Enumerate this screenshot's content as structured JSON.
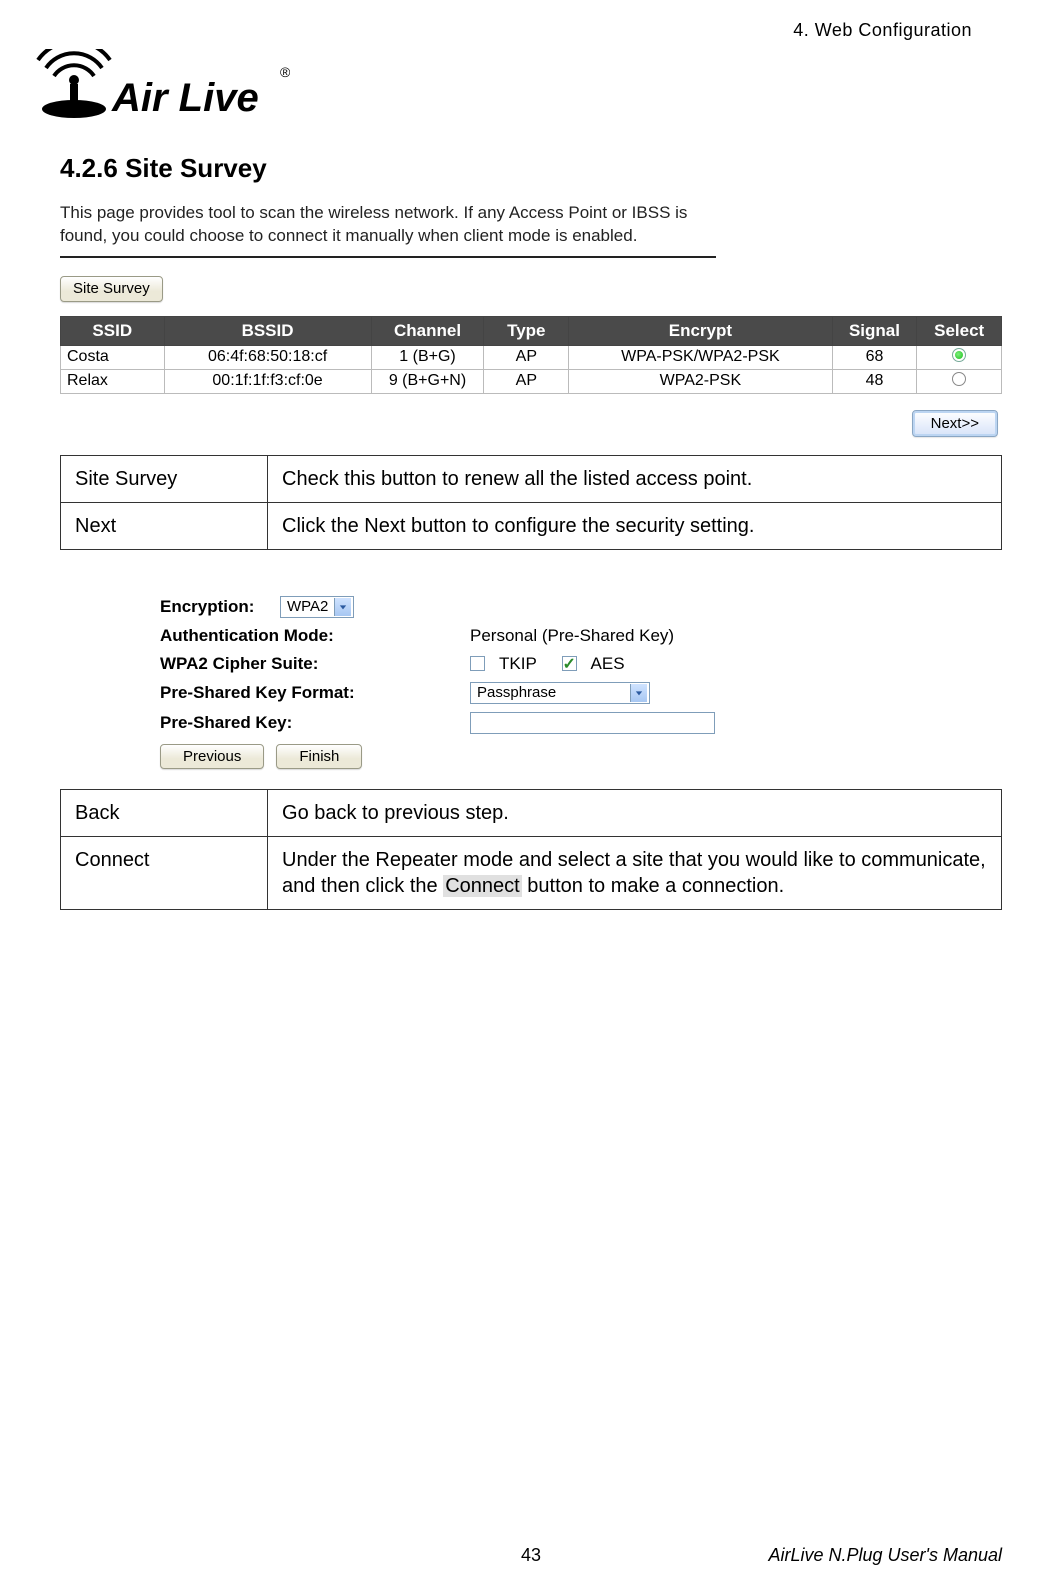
{
  "header": {
    "chapter": "4. Web Configuration",
    "logo_text": "Air Live",
    "logo_r": "®"
  },
  "section": {
    "number": "4.2.6",
    "title": "Site Survey"
  },
  "shot1": {
    "desc": "This page provides tool to scan the wireless network. If any Access Point or IBSS is found, you could choose to connect it manually when client mode is enabled.",
    "site_survey_btn": "Site Survey",
    "columns": {
      "ssid": "SSID",
      "bssid": "BSSID",
      "channel": "Channel",
      "type": "Type",
      "encrypt": "Encrypt",
      "signal": "Signal",
      "select": "Select"
    },
    "rows": [
      {
        "ssid": "Costa",
        "bssid": "06:4f:68:50:18:cf",
        "channel": "1 (B+G)",
        "type": "AP",
        "encrypt": "WPA-PSK/WPA2-PSK",
        "signal": "68",
        "selected": true
      },
      {
        "ssid": "Relax",
        "bssid": "00:1f:1f:f3:cf:0e",
        "channel": "9 (B+G+N)",
        "type": "AP",
        "encrypt": "WPA2-PSK",
        "signal": "48",
        "selected": false
      }
    ],
    "next_btn": "Next>>"
  },
  "table1": {
    "r0": {
      "k": "Site Survey",
      "v": "Check this button to renew all the listed access point."
    },
    "r1": {
      "k": "Next",
      "v": "Click the Next button to configure the security setting."
    }
  },
  "shot2": {
    "encryption_lbl": "Encryption:",
    "encryption_val": "WPA2",
    "auth_lbl": "Authentication Mode:",
    "auth_val": "Personal (Pre-Shared Key)",
    "cipher_lbl": "WPA2 Cipher Suite:",
    "cipher_tkip": "TKIP",
    "cipher_aes": "AES",
    "pskf_lbl": "Pre-Shared Key Format:",
    "pskf_val": "Passphrase",
    "psk_lbl": "Pre-Shared Key:",
    "prev_btn": "Previous",
    "finish_btn": "Finish"
  },
  "table2": {
    "r0": {
      "k": "Back",
      "v": "Go back to previous step."
    },
    "r1": {
      "k": "Connect",
      "pre": "Under the Repeater mode and select a site that you would like to communicate, and then click the ",
      "hi": "Connect",
      "post": " button to make a connection."
    }
  },
  "footer": {
    "page": "43",
    "manual": "AirLive N.Plug User's Manual"
  }
}
